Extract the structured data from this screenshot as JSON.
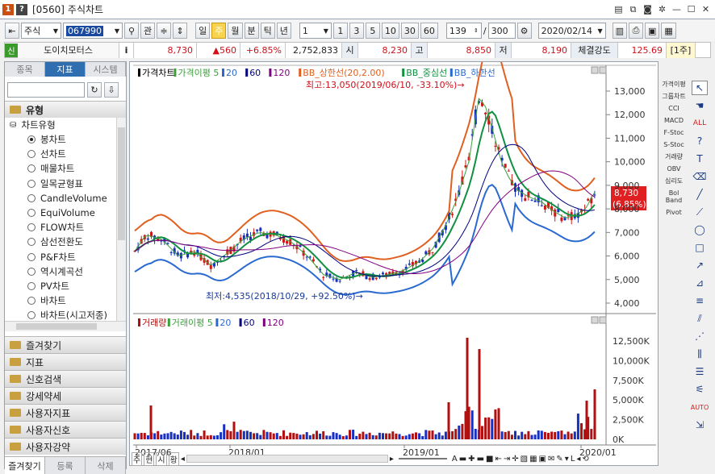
{
  "window": {
    "code": "[0560]",
    "title": "주식차트",
    "btn1": "1",
    "btn2": "?"
  },
  "toolbar": {
    "market": "주식",
    "code": "067990",
    "gwan": "관",
    "periods": [
      "일",
      "주",
      "월",
      "분",
      "틱",
      "년"
    ],
    "selected_period": "주",
    "count_box": "1",
    "counts": [
      "1",
      "3",
      "5",
      "10",
      "30",
      "60"
    ],
    "display": "139",
    "slash": "/",
    "total": "300",
    "date": "2020/02/14"
  },
  "quote": {
    "badge": "신",
    "name": "도이치모터스",
    "info": "i",
    "price": "8,730",
    "change": "▲560",
    "pct": "+6.85%",
    "volume": "2,752,833",
    "open_label": "시",
    "open": "8,230",
    "high_label": "고",
    "high": "8,850",
    "low_label": "저",
    "low": "8,190",
    "strength_label": "체결강도",
    "strength": "125.69",
    "unit": "[1주]"
  },
  "left": {
    "tabs": [
      "종목",
      "지표",
      "시스템"
    ],
    "active_tab": "지표",
    "category": "유형",
    "subcategory": "차트유형",
    "items": [
      "봉차트",
      "선차트",
      "매물차트",
      "일목균형표",
      "CandleVolume",
      "EquiVolume",
      "FLOW차트",
      "삼선전환도",
      "P&F차트",
      "역시계곡선",
      "PV차트",
      "바차트",
      "바차트(시고저종)"
    ],
    "selected_item": "봉차트",
    "folders": [
      "즐겨찾기",
      "지표",
      "신호검색",
      "강세약세",
      "사용자지표",
      "사용자신호",
      "사용자강약"
    ],
    "bottom_tabs": [
      "즐겨찾기",
      "등록",
      "삭제"
    ]
  },
  "chart": {
    "price_legend": [
      "가격차트",
      "가격이평 5",
      "20",
      "60",
      "120",
      "BB_상한선(20,2.00)",
      "BB_중심선",
      "BB_하한선"
    ],
    "price_legend_colors": [
      "#000000",
      "#3aa03a",
      "#2a6ad0",
      "#000080",
      "#800080",
      "#e06020",
      "#109040",
      "#2a6ad0"
    ],
    "high_note": "최고:13,050(2019/06/10, -33.10%)→",
    "low_note": "최저:4,535(2018/10/29, +92.50%)→",
    "cur_price": "8,730",
    "cur_pct": "(6.85%)",
    "y_labels": [
      "13,000",
      "12,000",
      "11,000",
      "10,000",
      "9,000",
      "8,000",
      "7,000",
      "6,000",
      "5,000",
      "4,000"
    ],
    "vol_legend": [
      "거래량",
      "거래이평 5",
      "20",
      "60",
      "120"
    ],
    "vol_labels": [
      "12,500K",
      "10,000K",
      "7,500K",
      "5,000K",
      "2,500K",
      "0K"
    ],
    "x_labels": [
      "2017/06",
      "2018/01",
      "2019/01",
      "2020/01"
    ],
    "bottom_btns": [
      "주",
      "현",
      "시",
      "황"
    ]
  },
  "tools": {
    "mid": [
      "가격이평",
      "그룹차트",
      "CCI",
      "MACD",
      "F-Stoc",
      "S-Stoc",
      "거래량",
      "OBV",
      "심리도",
      "Bol Band",
      "Pivot"
    ]
  }
}
